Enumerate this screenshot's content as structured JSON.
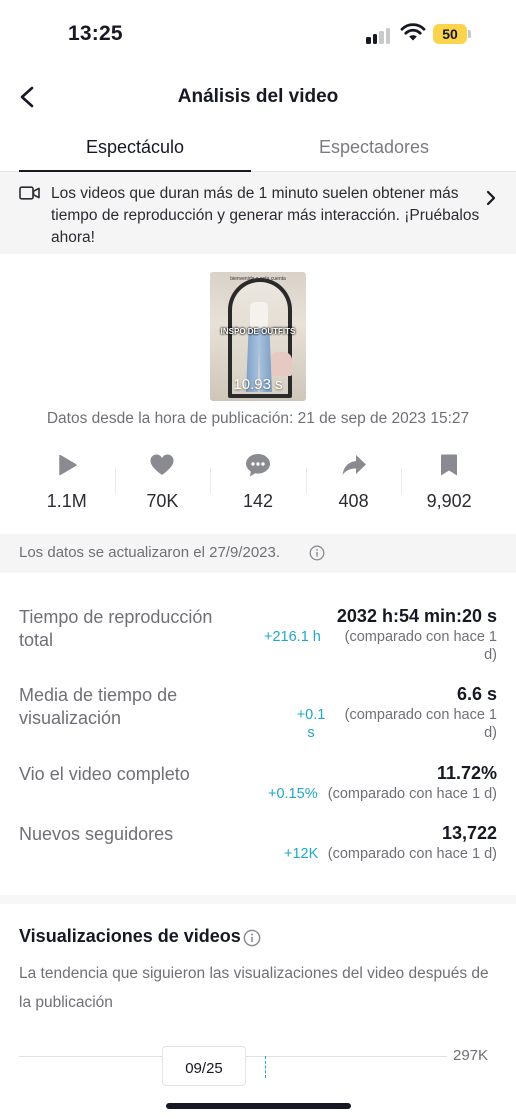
{
  "status_bar": {
    "time": "13:25",
    "battery": "50"
  },
  "header": {
    "title": "Análisis del video"
  },
  "tabs": [
    {
      "label": "Espectáculo",
      "active": true
    },
    {
      "label": "Espectadores",
      "active": false
    }
  ],
  "banner": {
    "text": "Los videos que duran más de 1 minuto suelen obtener más tiempo de reproducción y generar más interacción. ¡Pruébalos ahora!",
    "icon": "video-camera-icon"
  },
  "video": {
    "caption_small": "bienvenida a esta cuenta",
    "caption_main": "INSPO DE OUTFITS",
    "duration": "10.93 s"
  },
  "published": "Datos desde la hora de publicación: 21 de sep de 2023 15:27",
  "stats": [
    {
      "icon": "play-icon",
      "value": "1.1M"
    },
    {
      "icon": "heart-icon",
      "value": "70K"
    },
    {
      "icon": "comment-icon",
      "value": "142"
    },
    {
      "icon": "share-icon",
      "value": "408"
    },
    {
      "icon": "bookmark-icon",
      "value": "9,902"
    }
  ],
  "updated": "Los datos se actualizaron el 27/9/2023.",
  "metrics": {
    "watch_time": {
      "label": "Tiempo de reproducción total",
      "value": "2032 h:54 min:20 s",
      "delta": "+216.1 h",
      "compare": "(comparado con hace 1 d)"
    },
    "avg_watch": {
      "label": "Media de tiempo de visualización",
      "value": "6.6 s",
      "delta": "+0.1 s",
      "compare": "(comparado con hace 1 d)"
    },
    "completed": {
      "label": "Vio el video completo",
      "value": "11.72%",
      "delta": "+0.15%",
      "compare": "(comparado con hace 1 d)"
    },
    "followers": {
      "label": "Nuevos seguidores",
      "value": "13,722",
      "delta": "+12K",
      "compare": "(comparado con hace 1 d)"
    }
  },
  "views_section": {
    "title": "Visualizaciones de videos",
    "description": "La tendencia que siguieron las visualizaciones del video después de la publicación",
    "chart_max_label": "297K",
    "chart_date": "09/25"
  },
  "colors": {
    "accent": "#20a8c4",
    "battery": "#fcd34d",
    "text": "#161823",
    "muted": "#6f7077"
  }
}
